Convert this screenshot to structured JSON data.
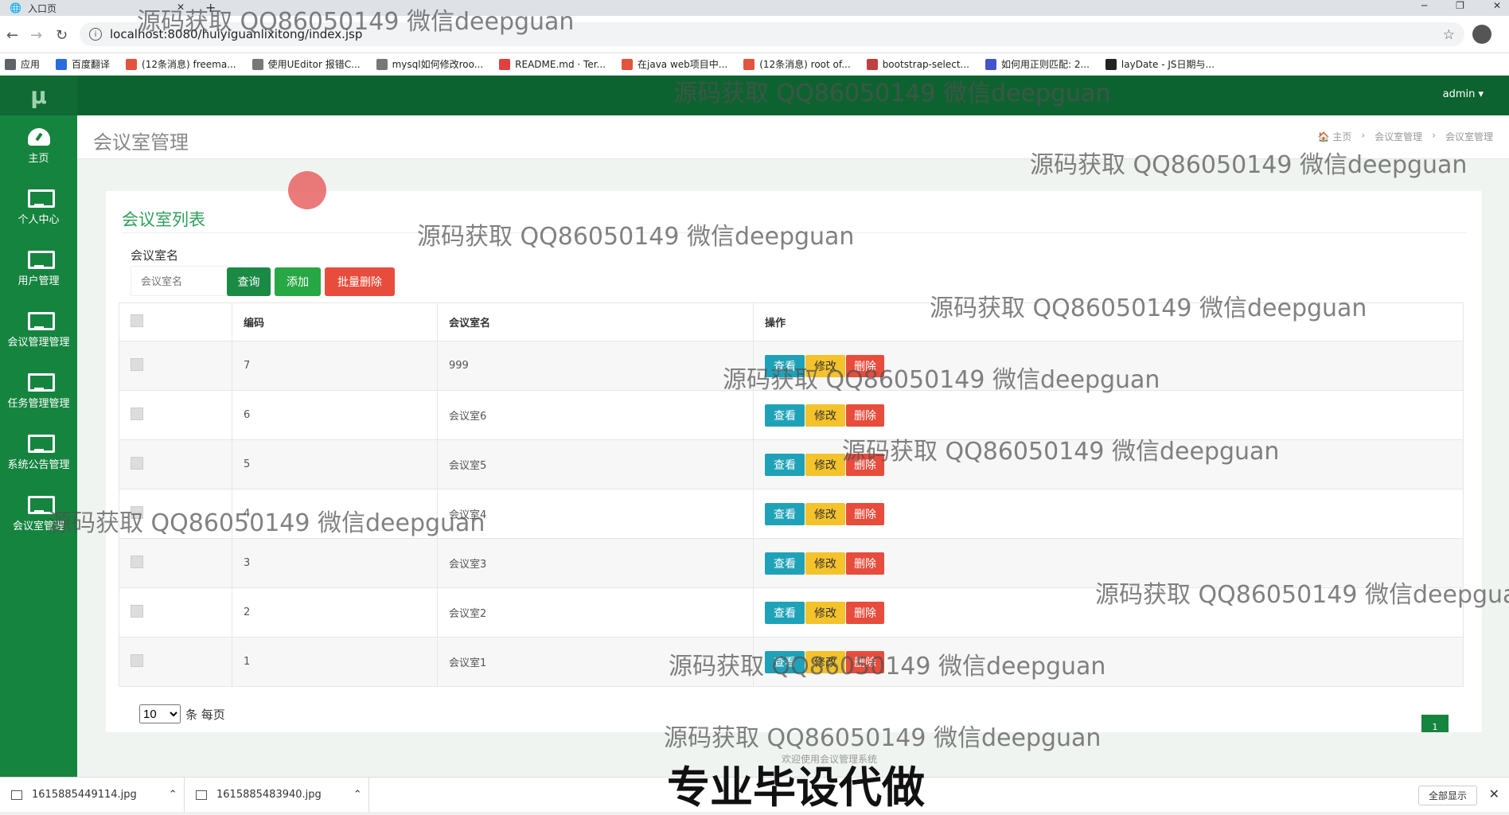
{
  "browser": {
    "tab_title": "入口页",
    "url": "localhost:8080/huiyiguanlixitong/index.jsp",
    "bookmarks": [
      "应用",
      "百度翻译",
      "(12条消息) freema...",
      "使用UEditor 报错C...",
      "mysql如何修改roo...",
      "README.md · Ter...",
      "在java web项目中...",
      "(12条消息) root of...",
      "bootstrap-select...",
      "如何用正则匹配: 2...",
      "layDate - JS日期与..."
    ]
  },
  "sidebar": {
    "logo": "μ",
    "items": [
      {
        "label": "主页",
        "icon": "dashboard-icon"
      },
      {
        "label": "个人中心",
        "icon": "monitor-icon"
      },
      {
        "label": "用户管理",
        "icon": "monitor-icon"
      },
      {
        "label": "会议管理管理",
        "icon": "monitor-icon"
      },
      {
        "label": "任务管理管理",
        "icon": "monitor-icon"
      },
      {
        "label": "系统公告管理",
        "icon": "monitor-icon"
      },
      {
        "label": "会议室管理",
        "icon": "monitor-icon"
      }
    ]
  },
  "topbar": {
    "user": "admin ▾"
  },
  "header": {
    "title": "会议室管理",
    "breadcrumb": [
      "🏠 主页",
      "›",
      "会议室管理",
      "›",
      "会议室管理"
    ]
  },
  "panel": {
    "title": "会议室列表",
    "search_label": "会议室名",
    "search_placeholder": "会议室名",
    "btn_query": "查询",
    "btn_add": "添加",
    "btn_batch_delete": "批量删除"
  },
  "table": {
    "headers": [
      "",
      "编码",
      "会议室名",
      "操作"
    ],
    "rows": [
      {
        "id": "7",
        "name": "999"
      },
      {
        "id": "6",
        "name": "会议室6"
      },
      {
        "id": "5",
        "name": "会议室5"
      },
      {
        "id": "4",
        "name": "会议室4"
      },
      {
        "id": "3",
        "name": "会议室3"
      },
      {
        "id": "2",
        "name": "会议室2"
      },
      {
        "id": "1",
        "name": "会议室1"
      }
    ],
    "op_view": "查看",
    "op_edit": "修改",
    "op_delete": "删除"
  },
  "pager": {
    "page_size": "10",
    "per_page_label": "条 每页",
    "current_page": "1"
  },
  "footer_note": "欢迎使用会议管理系统",
  "downloads": {
    "files": [
      "1615885449114.jpg",
      "1615885483940.jpg"
    ],
    "show_all": "全部显示"
  },
  "watermark": "源码获取 QQ86050149 微信deepguan",
  "bottom_banner": "专业毕设代做"
}
